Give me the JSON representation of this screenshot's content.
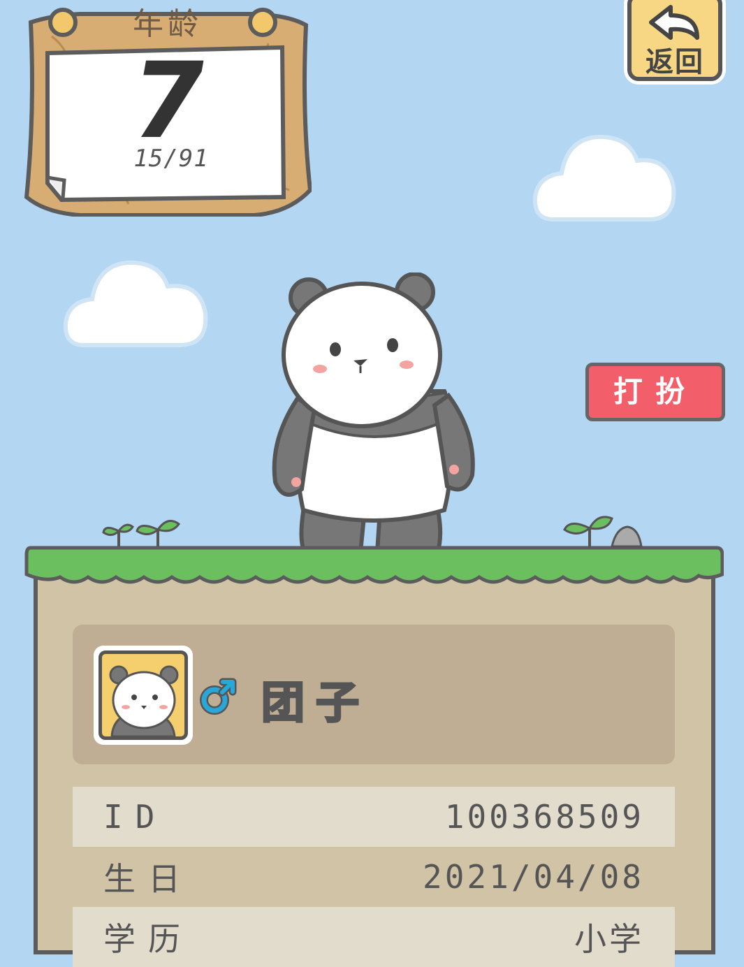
{
  "age_sign": {
    "title": "年龄",
    "age": "7",
    "progress": "15/91"
  },
  "back_button": {
    "label": "返回"
  },
  "dress_button": {
    "label": "打扮"
  },
  "profile": {
    "name": "团子",
    "gender_symbol": "♂",
    "gender_color": "#2aa7d9"
  },
  "info_rows": [
    {
      "label": "ID",
      "value": "100368509"
    },
    {
      "label": "生日",
      "value": "2021/04/08"
    },
    {
      "label": "学历",
      "value": "小学"
    }
  ],
  "colors": {
    "sky": "#b3d6f2",
    "grass": "#6bbf5f",
    "ground": "#d0c3a6",
    "dress_button": "#f25f6a",
    "back_button": "#f7d783"
  }
}
